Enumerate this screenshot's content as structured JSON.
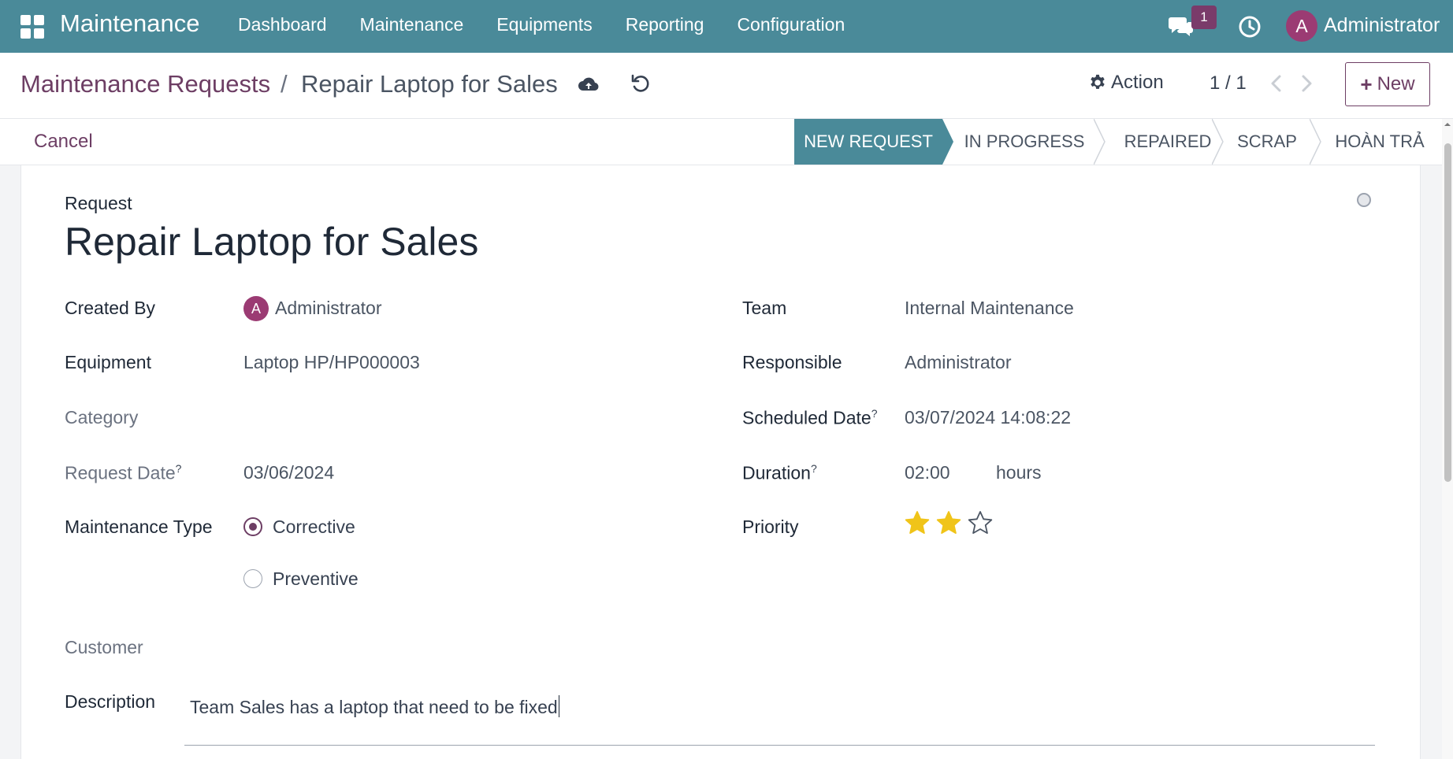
{
  "navbar": {
    "brand": "Maintenance",
    "menu": [
      "Dashboard",
      "Maintenance",
      "Equipments",
      "Reporting",
      "Configuration"
    ],
    "chat_count": "1",
    "user_initial": "A",
    "user_name": "Administrator"
  },
  "control": {
    "breadcrumb_parent": "Maintenance Requests",
    "breadcrumb_sep": "/",
    "breadcrumb_current": "Repair Laptop for Sales",
    "action_label": "Action",
    "pager": "1 / 1",
    "new_label": "New"
  },
  "status": {
    "cancel_label": "Cancel",
    "stages": [
      "NEW REQUEST",
      "IN PROGRESS",
      "REPAIRED",
      "SCRAP",
      "HOÀN TRẢ"
    ],
    "active_stage": "NEW REQUEST"
  },
  "form": {
    "section_label": "Request",
    "title": "Repair Laptop for Sales",
    "left": {
      "created_by_label": "Created By",
      "created_by_initial": "A",
      "created_by_value": "Administrator",
      "equipment_label": "Equipment",
      "equipment_value": "Laptop HP/HP000003",
      "category_label": "Category",
      "request_date_label": "Request Date",
      "request_date_help": "?",
      "request_date_value": "03/06/2024",
      "maintenance_type_label": "Maintenance Type",
      "maintenance_type_options": [
        "Corrective",
        "Preventive"
      ],
      "maintenance_type_selected": "Corrective",
      "customer_label": "Customer"
    },
    "right": {
      "team_label": "Team",
      "team_value": "Internal Maintenance",
      "responsible_label": "Responsible",
      "responsible_value": "Administrator",
      "scheduled_date_label": "Scheduled Date",
      "scheduled_date_help": "?",
      "scheduled_date_value": "03/07/2024 14:08:22",
      "duration_label": "Duration",
      "duration_help": "?",
      "duration_value": "02:00",
      "duration_unit": "hours",
      "priority_label": "Priority",
      "priority_stars": 2,
      "priority_max": 3
    },
    "description_label": "Description",
    "description_value": "Team Sales has a laptop that need to be fixed"
  },
  "colors": {
    "navbar": "#4a8a99",
    "brand_purple": "#6d3e64",
    "avatar": "#9b3b73",
    "star": "#f0c419"
  }
}
